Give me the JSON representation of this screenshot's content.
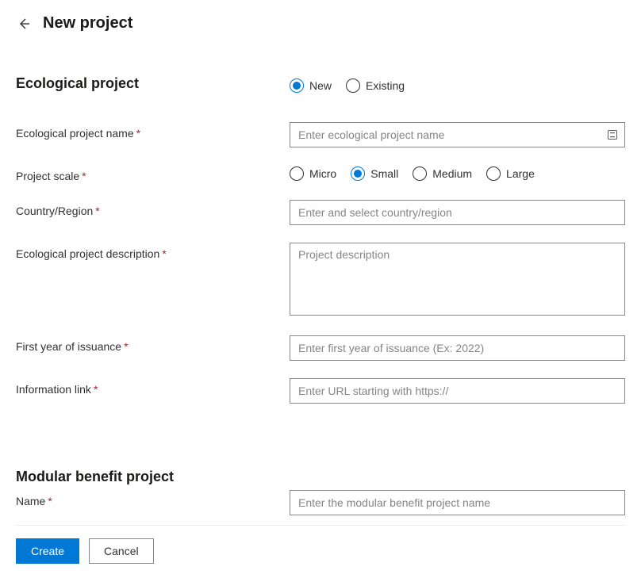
{
  "header": {
    "title": "New project"
  },
  "section1": {
    "title": "Ecological project",
    "type_row": {
      "options": [
        "New",
        "Existing"
      ],
      "selected": "New"
    },
    "name": {
      "label": "Ecological project name",
      "placeholder": "Enter ecological project name",
      "value": ""
    },
    "scale": {
      "label": "Project scale",
      "options": [
        "Micro",
        "Small",
        "Medium",
        "Large"
      ],
      "selected": "Small"
    },
    "country": {
      "label": "Country/Region",
      "placeholder": "Enter and select country/region",
      "value": ""
    },
    "description": {
      "label": "Ecological project description",
      "placeholder": "Project description",
      "value": ""
    },
    "first_year": {
      "label": "First year of issuance",
      "placeholder": "Enter first year of issuance (Ex: 2022)",
      "value": ""
    },
    "info_link": {
      "label": "Information link",
      "placeholder": "Enter URL starting with https://",
      "value": ""
    }
  },
  "section2": {
    "title": "Modular benefit project",
    "name": {
      "label": "Name",
      "placeholder": "Enter the modular benefit project name",
      "value": ""
    }
  },
  "footer": {
    "create": "Create",
    "cancel": "Cancel"
  }
}
